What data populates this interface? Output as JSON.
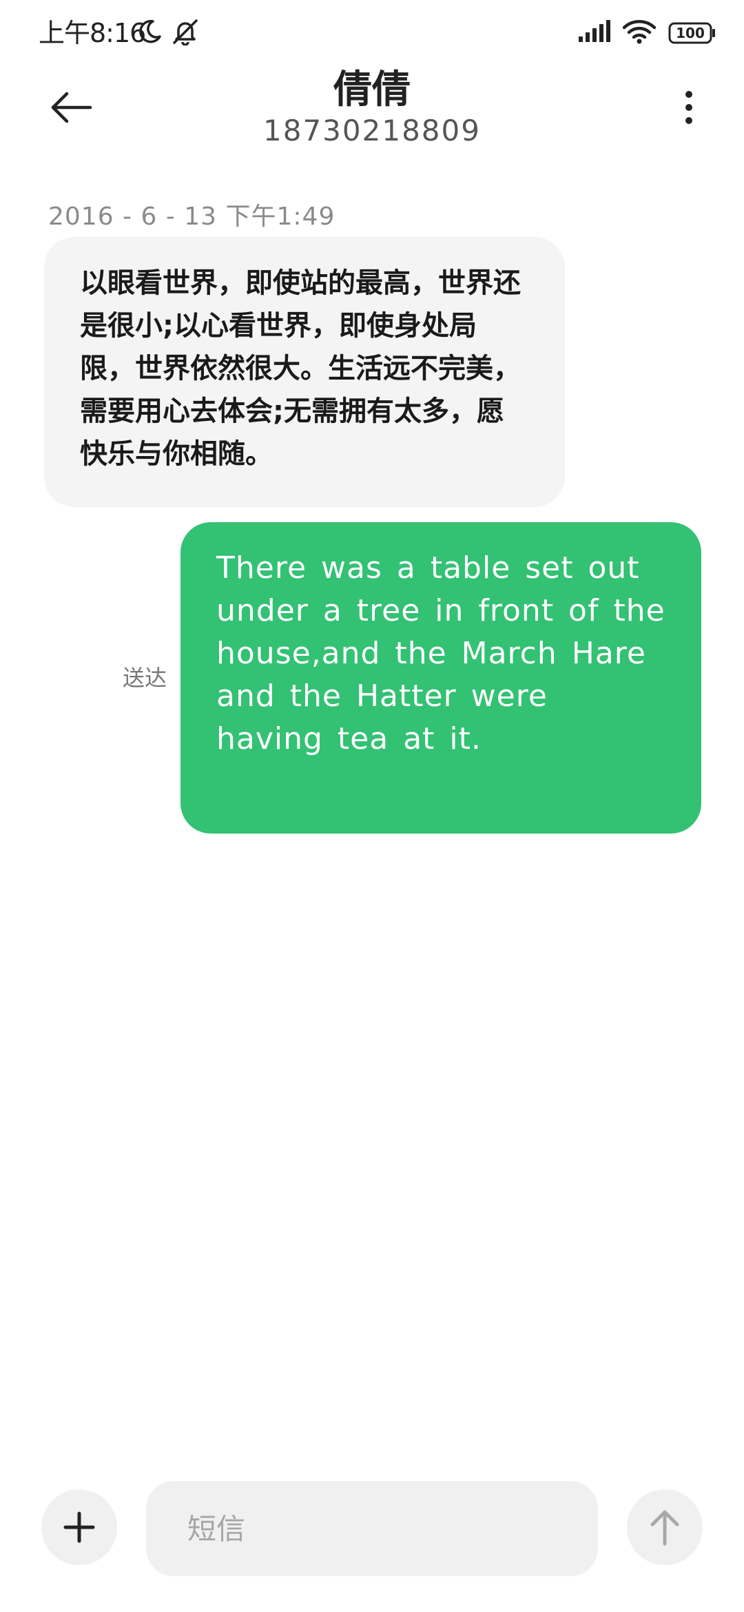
{
  "status_bar": {
    "time": "上午8:16",
    "left_icons": [
      "moon-icon",
      "bell-muted-icon"
    ],
    "right_icons": [
      "signal-icon",
      "wifi-icon",
      "battery-icon"
    ],
    "battery": "100"
  },
  "header": {
    "contact_name": "倩倩",
    "phone_number": "18730218809"
  },
  "messages": {
    "timestamp": "2016 - 6 - 13  下午1:49",
    "incoming_text": "以眼看世界，即使站的最高，世界还是很小;以心看世界，即使身处局限，世界依然很大。生活远不完美，需要用心去体会;无需拥有太多，愿快乐与你相随。",
    "outgoing_text": "There was a table set out under a tree in front of the house,and the March Hare and the Hatter were having tea at it.",
    "outgoing_status": "送达"
  },
  "composer": {
    "placeholder": "短信"
  },
  "colors": {
    "outgoing_bubble": "#33c173",
    "incoming_bubble": "#f4f4f4"
  }
}
